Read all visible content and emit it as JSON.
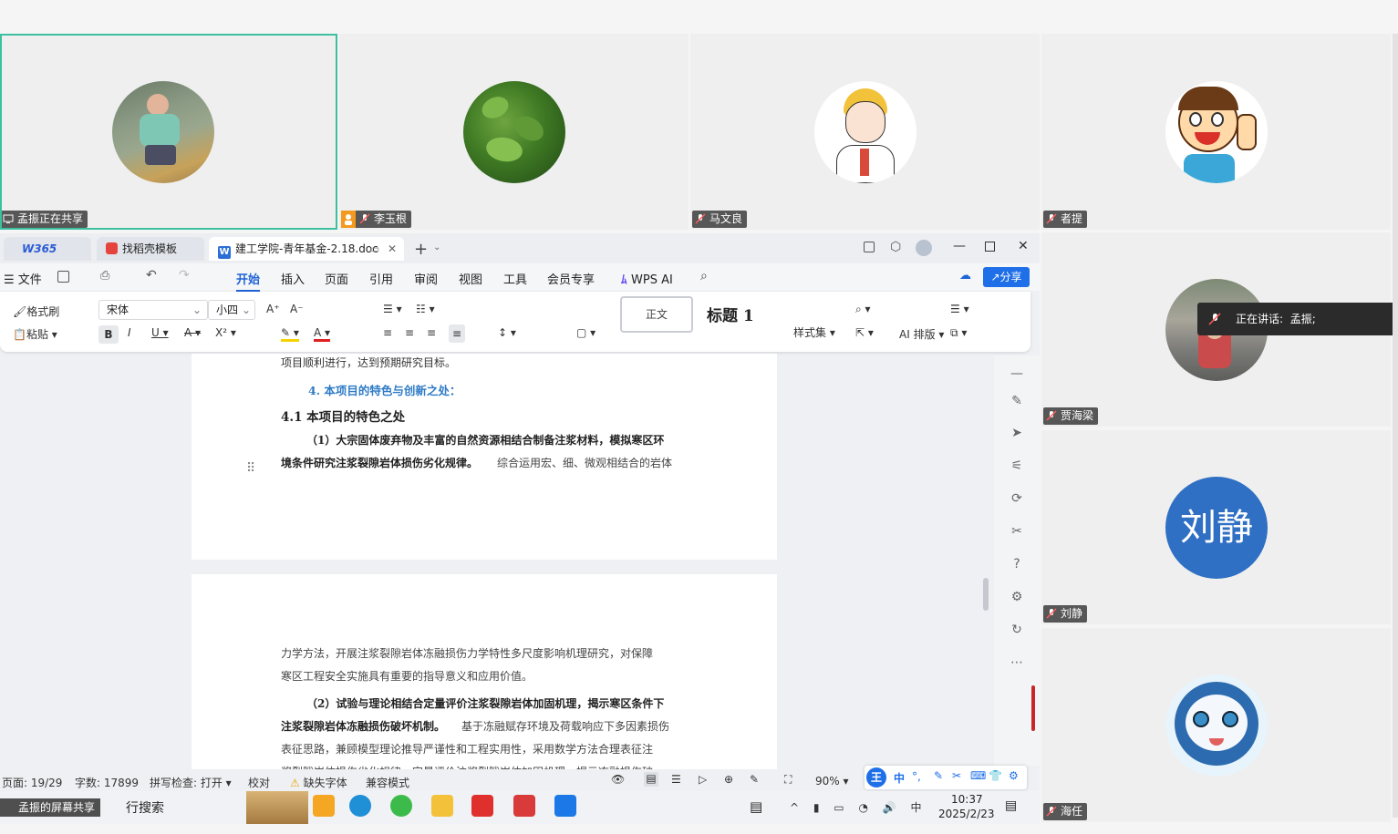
{
  "participants": [
    {
      "name": "孟振正在共享",
      "sharing": true
    },
    {
      "name": "李玉根"
    },
    {
      "name": "马文良"
    },
    {
      "name": "者提"
    },
    {
      "name": "贾海梁"
    },
    {
      "name": "刘静",
      "avatar_text": "刘静"
    },
    {
      "name": "海任"
    }
  ],
  "speaking": {
    "label": "正在讲话:",
    "name": "孟振;"
  },
  "wps": {
    "tabs": [
      {
        "label": "W365"
      },
      {
        "label": "找稻壳模板"
      },
      {
        "label": "建工学院-青年基金-2.18.doc"
      }
    ],
    "menu": [
      "文件",
      "开始",
      "插入",
      "页面",
      "引用",
      "审阅",
      "视图",
      "工具",
      "会员专享",
      "WPS AI"
    ],
    "share_label": "分享",
    "ribbon": {
      "format_painter": "格式刷",
      "paste": "粘贴",
      "font": "宋体",
      "size": "小四",
      "style_normal": "正文",
      "style_heading": "标题 1",
      "style_set": "样式集",
      "ai_layout": "AI 排版"
    }
  },
  "document": {
    "lines_top": [
      "项目顺利进行，达到预期研究目标。",
      "4.  本项目的特色与创新之处：",
      "4.1 本项目的特色之处",
      "（1）大宗固体废弃物及丰富的自然资源相结合制备注浆材料，模拟寒区环",
      "境条件研究注浆裂隙岩体损伤劣化规律。",
      "综合运用宏、细、微观相结合的岩体"
    ],
    "lines_bottom": [
      "力学方法，开展注浆裂隙岩体冻融损伤力学特性多尺度影响机理研究，对保障",
      "寒区工程安全实施具有重要的指导意义和应用价值。",
      "（2）试验与理论相结合定量评价注浆裂隙岩体加固机理，揭示寒区条件下",
      "注浆裂隙岩体冻融损伤破坏机制。",
      "基于冻融赋存环境及荷载响应下多因素损伤",
      "表征思路，兼顾模型理论推导严谨性和工程实用性，采用数学方法合理表征注",
      "浆裂隙岩体损伤劣化规律，定量评价注浆裂隙岩体加固机理，揭示冻融损伤破"
    ]
  },
  "status": {
    "page": "页面: 19/29",
    "words": "字数: 17899",
    "spell": "拼写检查: 打开",
    "proof": "校对",
    "missing_font": "缺失字体",
    "compat": "兼容模式",
    "zoom": "90%"
  },
  "ime": [
    "中",
    "°,"
  ],
  "taskbar": {
    "share_label": "孟振的屏幕共享",
    "search": "行搜索",
    "time": "10:37",
    "date": "2025/2/23"
  }
}
